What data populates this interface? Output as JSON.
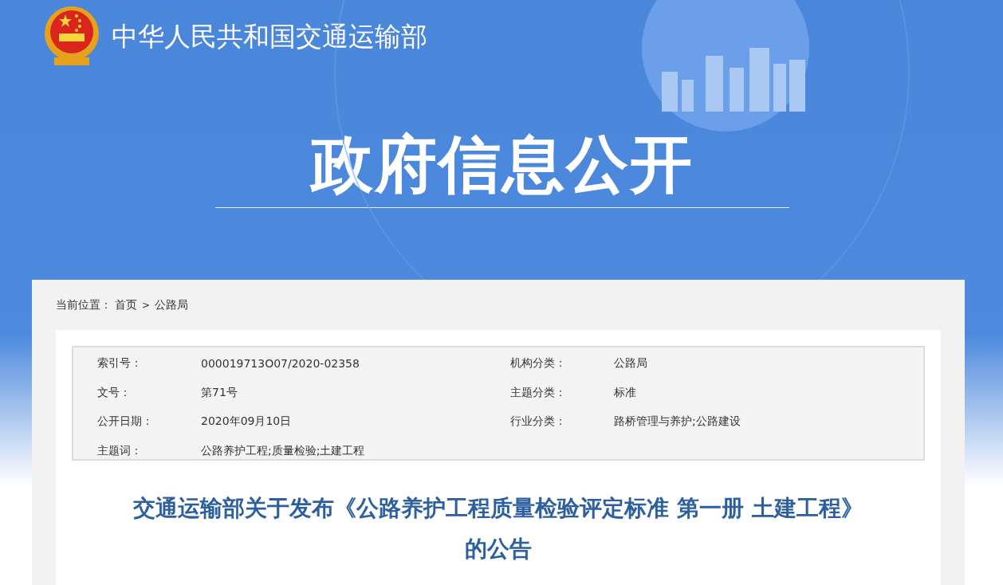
{
  "site": {
    "title": "中华人民共和国交通运输部"
  },
  "banner": {
    "heading": "政府信息公开"
  },
  "breadcrumb": {
    "label": "当前位置：",
    "items": [
      {
        "text": "首页"
      },
      {
        "text": "公路局"
      }
    ],
    "separator": ">"
  },
  "metadata": [
    {
      "label": "索引号：",
      "value": "000019713O07/2020-02358"
    },
    {
      "label": "机构分类：",
      "value": "公路局"
    },
    {
      "label": "文号：",
      "value": "第71号"
    },
    {
      "label": "主题分类：",
      "value": "标准"
    },
    {
      "label": "公开日期：",
      "value": "2020年09月10日"
    },
    {
      "label": "行业分类：",
      "value": "路桥管理与养护;公路建设"
    },
    {
      "label": "主题词：",
      "value": "公路养护工程;质量检验;土建工程"
    }
  ],
  "article": {
    "title_lines": [
      "交通运输部关于发布《公路养护工程质量检验评定标准 第一册 土建工程》",
      "的公告"
    ]
  }
}
